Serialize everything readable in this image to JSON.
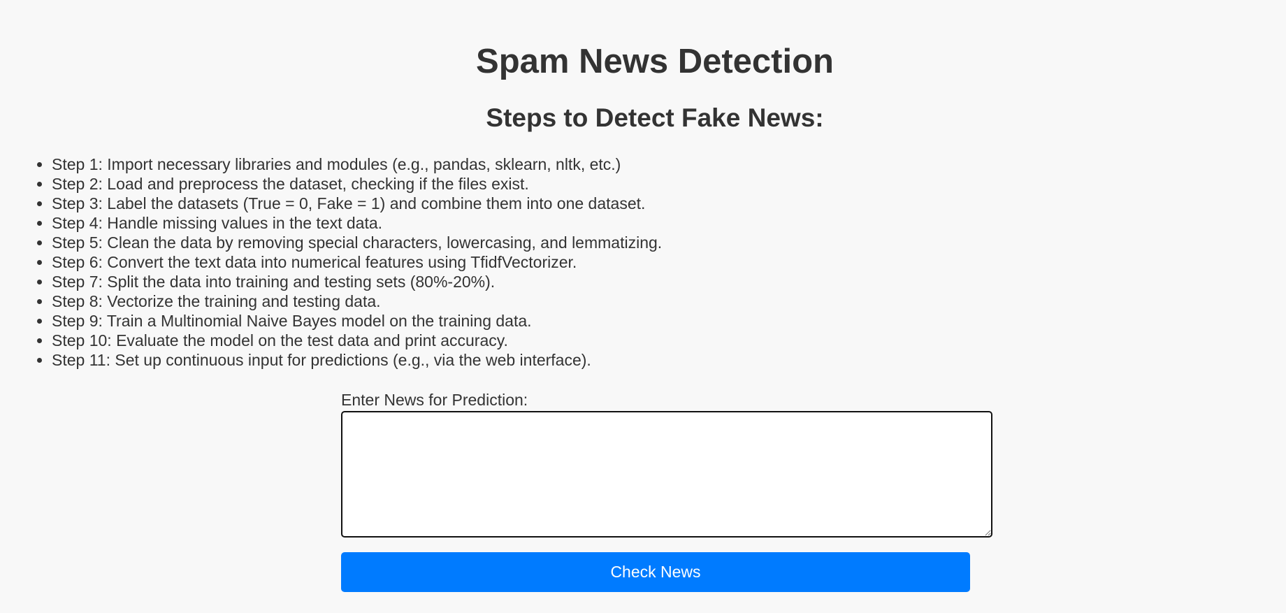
{
  "page": {
    "title": "Spam News Detection",
    "steps_heading": "Steps to Detect Fake News:"
  },
  "steps": [
    "Step 1: Import necessary libraries and modules (e.g., pandas, sklearn, nltk, etc.)",
    "Step 2: Load and preprocess the dataset, checking if the files exist.",
    "Step 3: Label the datasets (True = 0, Fake = 1) and combine them into one dataset.",
    "Step 4: Handle missing values in the text data.",
    "Step 5: Clean the data by removing special characters, lowercasing, and lemmatizing.",
    "Step 6: Convert the text data into numerical features using TfidfVectorizer.",
    "Step 7: Split the data into training and testing sets (80%-20%).",
    "Step 8: Vectorize the training and testing data.",
    "Step 9: Train a Multinomial Naive Bayes model on the training data.",
    "Step 10: Evaluate the model on the test data and print accuracy.",
    "Step 11: Set up continuous input for predictions (e.g., via the web interface)."
  ],
  "form": {
    "label": "Enter News for Prediction:",
    "input_value": "",
    "submit_label": "Check News"
  },
  "colors": {
    "background": "#f8f8f8",
    "text": "#333333",
    "accent": "#007bff"
  }
}
